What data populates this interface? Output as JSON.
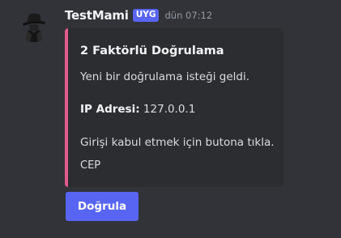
{
  "message": {
    "username": "TestMami",
    "role_tag": "UYG",
    "timestamp": "dün 07:12",
    "avatar_icon": "spy-agent-icon"
  },
  "embed": {
    "accent_color": "#e25a8b",
    "title": "2 Faktörlü Doğrulama",
    "description": "Yeni bir doğrulama isteği geldi.",
    "ip_label": "IP Adresi:",
    "ip_value": "127.0.0.1",
    "instruction": "Girişi kabul etmek için butona tıkla.",
    "footer_line": "CEP"
  },
  "button": {
    "label": "Doğrula",
    "color": "#5865f2"
  }
}
